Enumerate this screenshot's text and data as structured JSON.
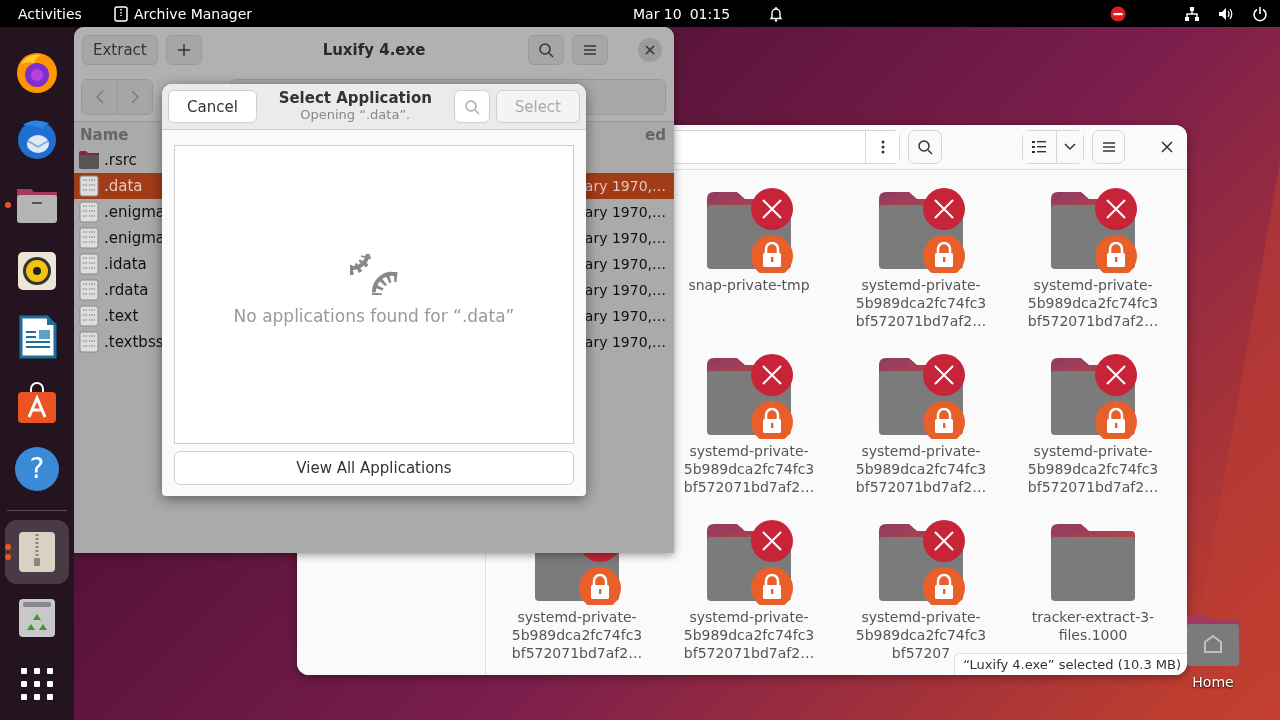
{
  "top_bar": {
    "activities": "Activities",
    "app_name": "Archive Manager",
    "date": "Mar 10",
    "time": "01:15"
  },
  "dock": {
    "items": [
      {
        "kind": "browser",
        "running": false,
        "focused": false
      },
      {
        "kind": "mail",
        "running": false,
        "focused": false
      },
      {
        "kind": "files",
        "running": true,
        "multiple_windows": false,
        "focused": false
      },
      {
        "kind": "music",
        "running": false,
        "focused": false
      },
      {
        "kind": "writer",
        "running": false,
        "focused": false
      },
      {
        "kind": "software",
        "running": false,
        "focused": false
      },
      {
        "kind": "help",
        "glyph": "?",
        "running": false,
        "focused": false
      },
      {
        "kind": "separator"
      },
      {
        "kind": "archive",
        "running": true,
        "multiple_windows": true,
        "focused": true
      },
      {
        "kind": "trash",
        "running": false,
        "focused": false
      },
      {
        "kind": "apps",
        "running": false,
        "focused": false
      }
    ]
  },
  "archive_manager": {
    "extract_button": "Extract",
    "title": "Luxify 4.exe",
    "columns": [
      {
        "label": "Name"
      },
      {
        "label": "ed"
      }
    ],
    "rows": [
      {
        "kind": "folder",
        "name": ".rsrc",
        "selected": false
      },
      {
        "kind": "binary",
        "name": ".data",
        "date": "ary 1970,…",
        "selected": true
      },
      {
        "kind": "binary",
        "name": ".enigma",
        "date": "ary 1970,…",
        "selected": false
      },
      {
        "kind": "binary",
        "name": ".enigma",
        "date": "ary 1970,…",
        "selected": false
      },
      {
        "kind": "binary",
        "name": ".idata",
        "date": "ary 1970,…",
        "selected": false
      },
      {
        "kind": "binary",
        "name": ".rdata",
        "date": "ary 1970,…",
        "selected": false
      },
      {
        "kind": "binary",
        "name": ".text",
        "date": "ary 1970,…",
        "selected": false
      },
      {
        "kind": "binary",
        "name": ".textbss",
        "date": "ary 1970,…",
        "selected": false
      }
    ]
  },
  "dialog": {
    "cancel": "Cancel",
    "title": "Select Application",
    "subtitle": "Opening “.data”.",
    "select": "Select",
    "select_disabled": true,
    "empty_message": "No applications found for “.data”",
    "view_all": "View All Applications"
  },
  "files": {
    "rows": [
      [
        "",
        {
          "name_lines": [
            "snap-private-tmp"
          ],
          "locked": true
        },
        {
          "name_lines": [
            "systemd-private-",
            "5b989dca2fc74fc3",
            "bf572071bd7af2…"
          ],
          "locked": true
        },
        {
          "name_lines": [
            "systemd-private-",
            "5b989dca2fc74fc3",
            "bf572071bd7af2…"
          ],
          "locked": true
        }
      ],
      [
        "",
        {
          "name_lines": [
            "systemd-private-",
            "5b989dca2fc74fc3",
            "bf572071bd7af2…"
          ],
          "locked": true
        },
        {
          "name_lines": [
            "systemd-private-",
            "5b989dca2fc74fc3",
            "bf572071bd7af2…"
          ],
          "locked": true
        },
        {
          "name_lines": [
            "systemd-private-",
            "5b989dca2fc74fc3",
            "bf572071bd7af2…"
          ],
          "locked": true
        }
      ],
      [
        {
          "name_lines": [
            "systemd-private-",
            "5b989dca2fc74fc3",
            "bf572071bd7af2…"
          ],
          "locked": true
        },
        {
          "name_lines": [
            "systemd-private-",
            "5b989dca2fc74fc3",
            "bf572071bd7af2…"
          ],
          "locked": true
        },
        {
          "name_lines": [
            "systemd-private-",
            "5b989dca2fc74fc3",
            "bf57207"
          ],
          "locked": true
        },
        {
          "name_lines": [
            "tracker-extract-3-",
            "files.1000"
          ],
          "locked": false
        }
      ]
    ],
    "status": "“Luxify 4.exe” selected (10.3 MB)"
  },
  "desktop": {
    "home_label": "Home"
  }
}
